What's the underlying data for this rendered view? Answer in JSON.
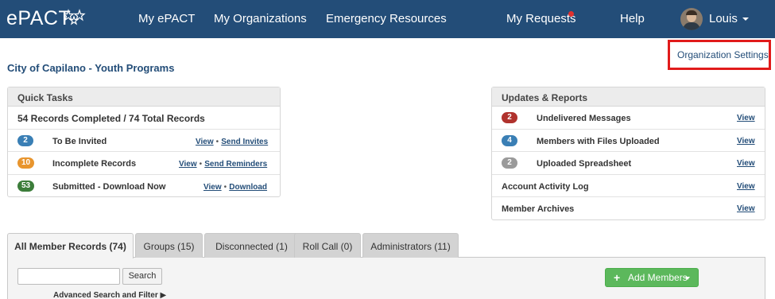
{
  "nav": {
    "logo": "ePACT",
    "items": [
      "My ePACT",
      "My Organizations",
      "Emergency Resources"
    ],
    "requests": "My Requests",
    "help": "Help",
    "user": "Louis"
  },
  "org_settings": "Organization Settings",
  "page_title": "City of Capilano - Youth Programs",
  "quick_tasks": {
    "title": "Quick Tasks",
    "summary": "54 Records Completed / 74 Total Records",
    "rows": [
      {
        "badge": "2",
        "badge_color": "#3a7fb5",
        "label": "To Be Invited",
        "link1": "View",
        "link2": "Send Invites"
      },
      {
        "badge": "10",
        "badge_color": "#e8952e",
        "label": "Incomplete Records",
        "link1": "View",
        "link2": "Send Reminders"
      },
      {
        "badge": "53",
        "badge_color": "#3c7d3a",
        "label": "Submitted - Download Now",
        "link1": "View",
        "link2": "Download"
      }
    ],
    "separator": "•"
  },
  "updates": {
    "title": "Updates & Reports",
    "rows": [
      {
        "badge": "2",
        "badge_color": "#b0322d",
        "label": "Undelivered Messages",
        "link": "View"
      },
      {
        "badge": "4",
        "badge_color": "#3a7fb5",
        "label": "Members with Files Uploaded",
        "link": "View"
      },
      {
        "badge": "2",
        "badge_color": "#9a9a9a",
        "label": "Uploaded Spreadsheet",
        "link": "View"
      },
      {
        "badge": "",
        "label": "Account Activity Log",
        "link": "View"
      },
      {
        "badge": "",
        "label": "Member Archives",
        "link": "View"
      }
    ]
  },
  "tabs": [
    "All Member Records (74)",
    "Groups (15)",
    "Disconnected (1)",
    "Roll Call (0)",
    "Administrators (11)"
  ],
  "search": {
    "button": "Search",
    "advanced": "Advanced Search and Filter ▶"
  },
  "add_members": "Add Members",
  "colors": {
    "nav_bg": "#234d78",
    "highlight": "#e11b1b",
    "add_button": "#5cb85c"
  }
}
